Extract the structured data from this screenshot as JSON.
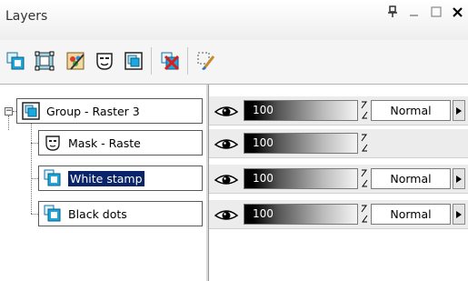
{
  "window": {
    "title": "Layers"
  },
  "title_controls": [
    "pin-icon",
    "minimize-icon",
    "maximize-icon",
    "close-icon"
  ],
  "toolbar": {
    "buttons": [
      "new-raster-layer-icon",
      "new-vector-layer-icon",
      "new-art-media-layer-icon",
      "new-mask-layer-icon",
      "new-group-layer-icon",
      "delete-layer-icon",
      "edit-selection-brush-icon"
    ]
  },
  "layers": [
    {
      "name": "Group - Raster 3",
      "type": "group",
      "icon": "group-layer-icon",
      "opacity": "100",
      "blend_mode": "Normal",
      "selected": false
    },
    {
      "name": "Mask - Raste",
      "type": "mask",
      "icon": "mask-layer-icon",
      "opacity": "100",
      "blend_mode": "",
      "selected": false
    },
    {
      "name": "White stamp",
      "type": "raster",
      "icon": "raster-layer-icon",
      "opacity": "100",
      "blend_mode": "Normal",
      "selected": true
    },
    {
      "name": "Black dots",
      "type": "raster",
      "icon": "raster-layer-icon",
      "opacity": "100",
      "blend_mode": "Normal",
      "selected": false
    }
  ],
  "colors": {
    "selection": "#0a246a",
    "raster_icon": "#19a3d6",
    "toolbar_bg": "#f5f5f5"
  }
}
